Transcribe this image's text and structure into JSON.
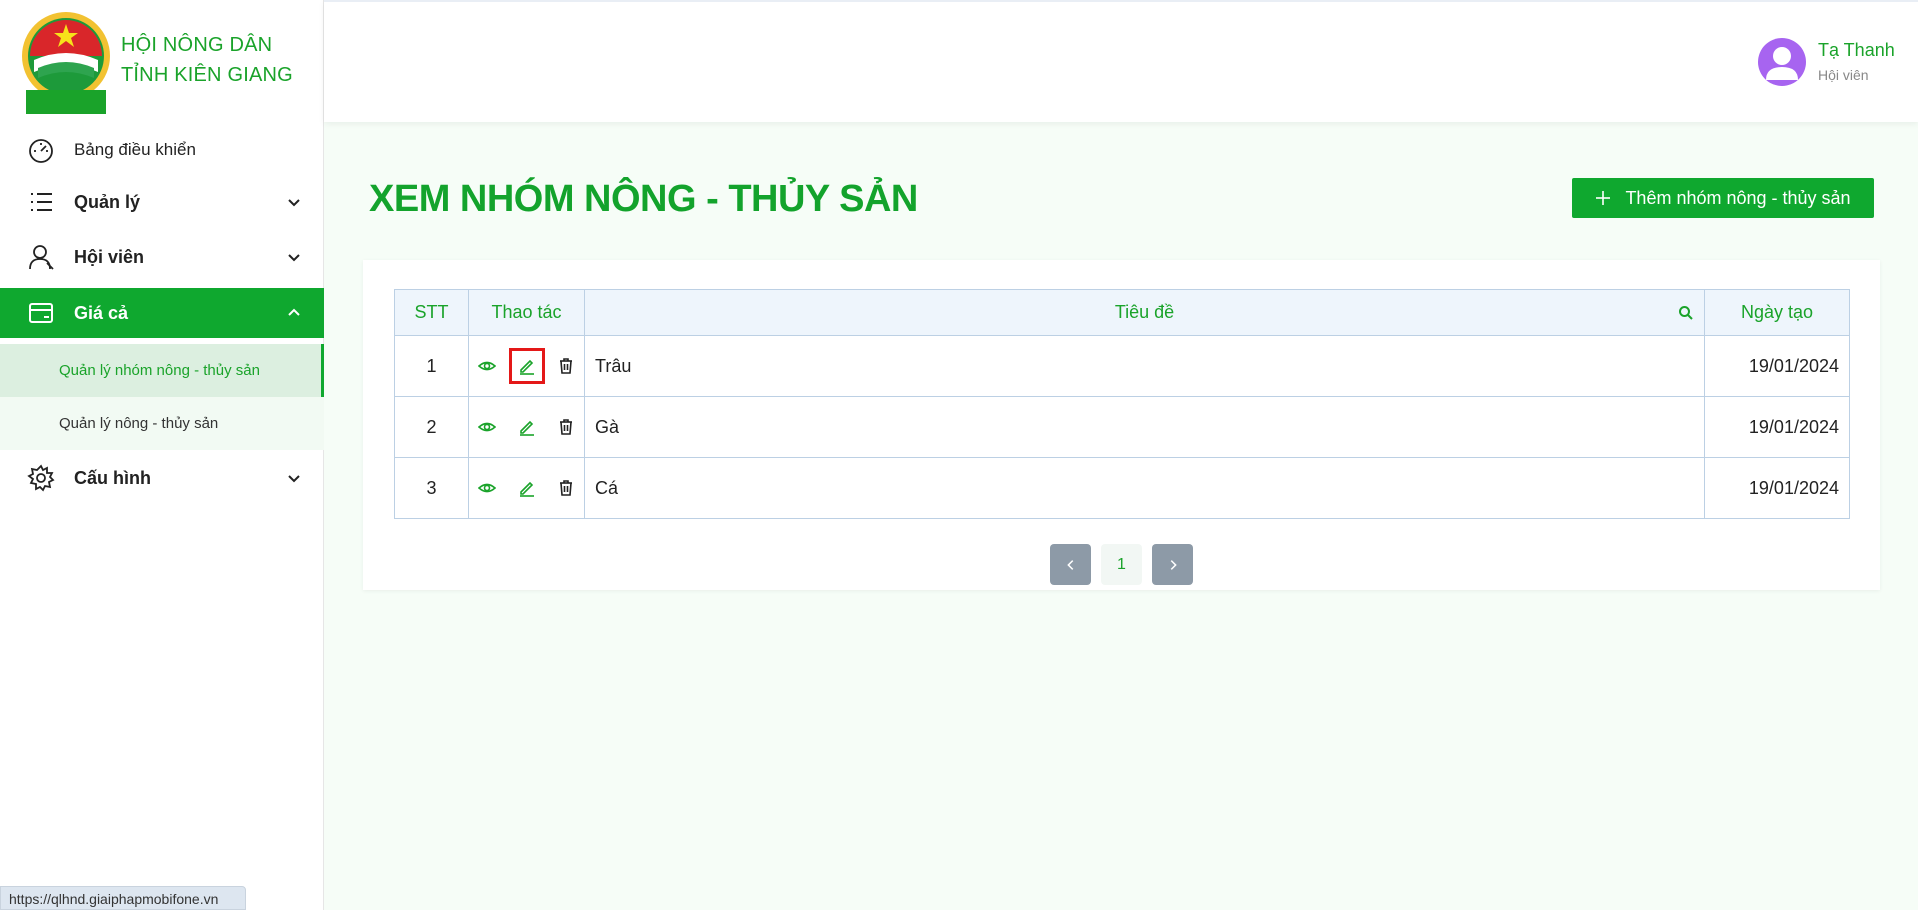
{
  "brand": {
    "title": "HỘI NÔNG DÂN TỈNH KIÊN GIANG",
    "logo_text": "HỘI NÔNG DÂN TỈNH KIÊN GIANG"
  },
  "sidebar": {
    "items": [
      {
        "label": "Bảng điều khiển",
        "icon": "dashboard-icon"
      },
      {
        "label": "Quản lý",
        "icon": "list-icon"
      },
      {
        "label": "Hội viên",
        "icon": "user-icon"
      },
      {
        "label": "Giá cả",
        "icon": "card-icon"
      },
      {
        "label": "Cấu hình",
        "icon": "gear-icon"
      }
    ],
    "sub_items": [
      {
        "label": "Quản lý nhóm nông - thủy sản"
      },
      {
        "label": "Quản lý nông - thủy sản"
      }
    ]
  },
  "status_bar": {
    "url": "https://qlhnd.giaiphapmobifone.vn"
  },
  "user": {
    "name": "Tạ Thanh",
    "role": "Hội viên"
  },
  "page": {
    "title": "XEM NHÓM NÔNG - THỦY SẢN",
    "add_button": "Thêm nhóm nông - thủy sản"
  },
  "table": {
    "columns": [
      "STT",
      "Thao tác",
      "Tiêu đề",
      "Ngày tạo"
    ],
    "rows": [
      {
        "stt": "1",
        "title": "Trâu",
        "date": "19/01/2024"
      },
      {
        "stt": "2",
        "title": "Gà",
        "date": "19/01/2024"
      },
      {
        "stt": "3",
        "title": "Cá",
        "date": "19/01/2024"
      }
    ]
  },
  "pagination": {
    "current": "1"
  },
  "colors": {
    "accent": "#0fa82f",
    "highlight": "#e41818"
  }
}
